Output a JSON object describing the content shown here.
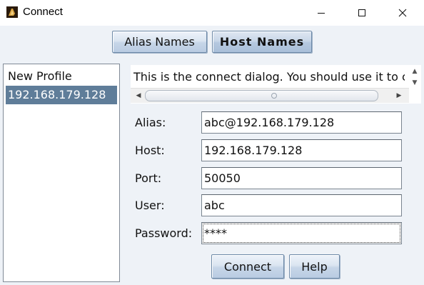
{
  "window": {
    "title": "Connect"
  },
  "toolbar": {
    "alias_names_label": "Alias Names",
    "host_names_label": "Host Names"
  },
  "profiles": {
    "items": [
      {
        "label": "New Profile",
        "selected": false
      },
      {
        "label": "192.168.179.128",
        "selected": true
      }
    ]
  },
  "info": {
    "text": "This is the connect dialog. You should use it to c"
  },
  "form": {
    "alias_label": "Alias:",
    "alias_value": "abc@192.168.179.128",
    "host_label": "Host:",
    "host_value": "192.168.179.128",
    "port_label": "Port:",
    "port_value": "50050",
    "user_label": "User:",
    "user_value": "abc",
    "password_label": "Password:",
    "password_value": "****"
  },
  "actions": {
    "connect_label": "Connect",
    "help_label": "Help"
  },
  "colors": {
    "selection": "#5f7d99",
    "background": "#eef2f7"
  }
}
